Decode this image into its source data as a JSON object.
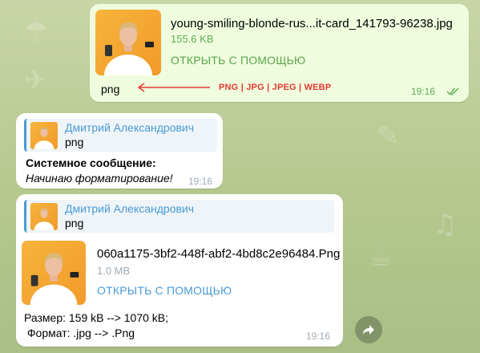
{
  "colors": {
    "out_bubble": "#effdde",
    "in_bubble": "#ffffff",
    "out_link": "#5aa54a",
    "in_link": "#4a9bd4",
    "out_meta": "#62ac55",
    "in_meta": "#a0acb6",
    "annotation": "#e53935"
  },
  "message1": {
    "file_name": "young-smiling-blonde-rus...it-card_141793-96238.jpg",
    "file_size": "155.6 KB",
    "open_label": "ОТКРЫТЬ С ПОМОЩЬЮ",
    "caption": "png",
    "time": "19:16",
    "status_icon": "double-check-icon"
  },
  "annotation": {
    "text": "PNG | JPG | JPEG | WEBP",
    "icon": "arrow-left-icon"
  },
  "message2": {
    "reply_name": "Дмитрий Александрович",
    "reply_text": "png",
    "line1": "Системное сообщение:",
    "line2": "Начинаю форматирование!",
    "time": "19:16"
  },
  "message3": {
    "reply_name": "Дмитрий Александрович",
    "reply_text": "png",
    "file_name": "060a1175-3bf2-448f-abf2-4bd8c2e96484.Png",
    "file_size": "1.0 MB",
    "open_label": "ОТКРЫТЬ С ПОМОЩЬЮ",
    "line1": "Размер: 159 kB --> 1070 kB;",
    "line2": " Формат: .jpg --> .Png",
    "time": "19:16"
  },
  "share_button": {
    "icon": "share-arrow-icon"
  }
}
